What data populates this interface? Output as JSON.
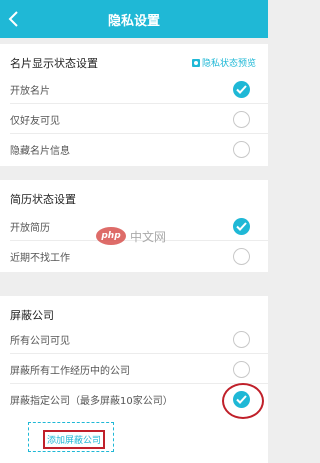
{
  "header": {
    "title": "隐私设置",
    "back_icon": "chevron-left-icon"
  },
  "card_section": {
    "title": "名片显示状态设置",
    "link": "隐私状态预览",
    "options": [
      {
        "label": "开放名片",
        "checked": true
      },
      {
        "label": "仅好友可见",
        "checked": false
      },
      {
        "label": "隐藏名片信息",
        "checked": false
      }
    ]
  },
  "resume_section": {
    "title": "简历状态设置",
    "options": [
      {
        "label": "开放简历",
        "checked": true
      },
      {
        "label": "近期不找工作",
        "checked": false
      }
    ]
  },
  "block_section": {
    "title": "屏蔽公司",
    "options": [
      {
        "label": "所有公司可见",
        "checked": false
      },
      {
        "label": "屏蔽所有工作经历中的公司",
        "checked": false
      },
      {
        "label": "屏蔽指定公司（最多屏蔽10家公司）",
        "checked": true
      }
    ],
    "add_button": "添加屏蔽公司"
  },
  "watermark": {
    "logo": "php",
    "text": "中文网"
  },
  "colors": {
    "accent": "#1fb8d6",
    "annotation": "#c0202a"
  }
}
